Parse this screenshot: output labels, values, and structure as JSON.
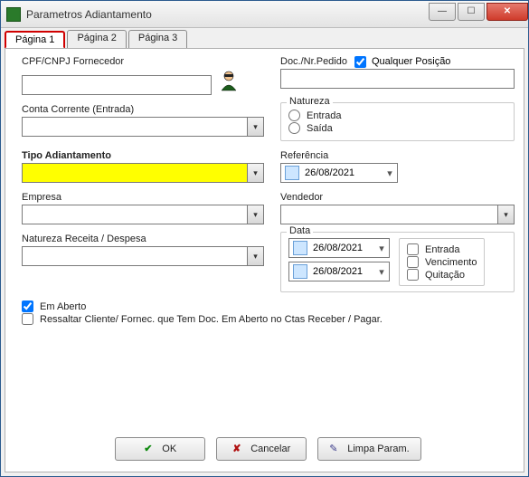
{
  "window": {
    "title": "Parametros Adiantamento"
  },
  "tabs": [
    {
      "label": "Página 1",
      "active": true
    },
    {
      "label": "Página 2",
      "active": false
    },
    {
      "label": "Página 3",
      "active": false
    }
  ],
  "left": {
    "cpf_label": "CPF/CNPJ Fornecedor",
    "cpf_value": "",
    "conta_label": "Conta Corrente (Entrada)",
    "conta_value": "",
    "tipo_label": "Tipo Adiantamento",
    "tipo_value": "",
    "empresa_label": "Empresa",
    "empresa_value": "",
    "natrd_label": "Natureza Receita / Despesa",
    "natrd_value": "",
    "em_aberto_label": "Em Aberto",
    "em_aberto_checked": true,
    "ressaltar_label": "Ressaltar Cliente/ Fornec. que Tem  Doc. Em Aberto no  Ctas Receber / Pagar.",
    "ressaltar_checked": false
  },
  "right": {
    "doc_label": "Doc./Nr.Pedido",
    "qualquer_label": "Qualquer Posição",
    "qualquer_checked": true,
    "doc_value": "",
    "natureza_label": "Natureza",
    "natureza_entrada": "Entrada",
    "natureza_saida": "Saída",
    "referencia_label": "Referência",
    "referencia_value": "26/08/2021",
    "vendedor_label": "Vendedor",
    "vendedor_value": "",
    "data_label": "Data",
    "data_from": "26/08/2021",
    "data_to": "26/08/2021",
    "data_entrada": "Entrada",
    "data_vencimento": "Vencimento",
    "data_quitacao": "Quitação"
  },
  "buttons": {
    "ok": "OK",
    "cancel": "Cancelar",
    "clear": "Limpa Param."
  }
}
